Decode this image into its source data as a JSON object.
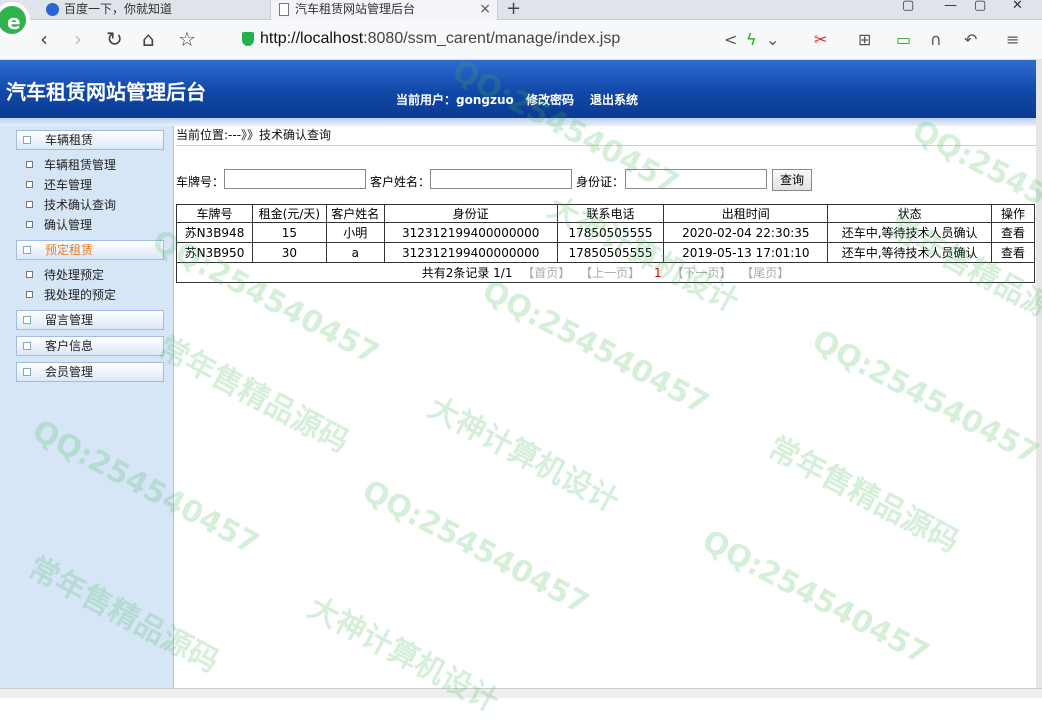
{
  "browser": {
    "tabs": [
      {
        "title": "百度一下，你就知道"
      },
      {
        "title": "汽车租赁网站管理后台"
      }
    ],
    "url_host": "http://localhost",
    "url_path": ":8080/ssm_carent/manage/index.jsp"
  },
  "header": {
    "title": "汽车租赁网站管理后台",
    "current_user": "当前用户：gongzuo",
    "change_password": "修改密码",
    "logout": "退出系统"
  },
  "sidebar": {
    "sections": [
      {
        "label": "车辆租赁",
        "items": [
          "车辆租赁管理",
          "还车管理",
          "技术确认查询",
          "确认管理"
        ]
      },
      {
        "label": "预定租赁",
        "items": [
          "待处理预定",
          "我处理的预定"
        ]
      },
      {
        "label": "留言管理",
        "items": []
      },
      {
        "label": "客户信息",
        "items": []
      },
      {
        "label": "会员管理",
        "items": []
      }
    ]
  },
  "breadcrumb": "当前位置:---》》技术确认查询",
  "search": {
    "plate_label": "车牌号：",
    "name_label": "客户姓名：",
    "id_label": "身份证：",
    "button": "查询"
  },
  "table": {
    "headers": [
      "车牌号",
      "租金(元/天)",
      "客户姓名",
      "身份证",
      "联系电话",
      "出租时间",
      "状态",
      "操作"
    ],
    "rows": [
      [
        "苏N3B948",
        "15",
        "小明",
        "312312199400000000",
        "17850505555",
        "2020-02-04 22:30:35",
        "还车中,等待技术人员确认",
        "查看"
      ],
      [
        "苏N3B950",
        "30",
        "a",
        "312312199400000000",
        "17850505555",
        "2019-05-13 17:01:10",
        "还车中,等待技术人员确认",
        "查看"
      ]
    ],
    "pager": {
      "summary": "共有2条记录  1/1",
      "first": "【首页】",
      "prev": "【上一页】",
      "current": "1",
      "next": "【下一页】",
      "last": "【尾页】"
    }
  },
  "watermarks": [
    "QQ:254540457",
    "大神计算机设计",
    "常年售精品源码"
  ]
}
